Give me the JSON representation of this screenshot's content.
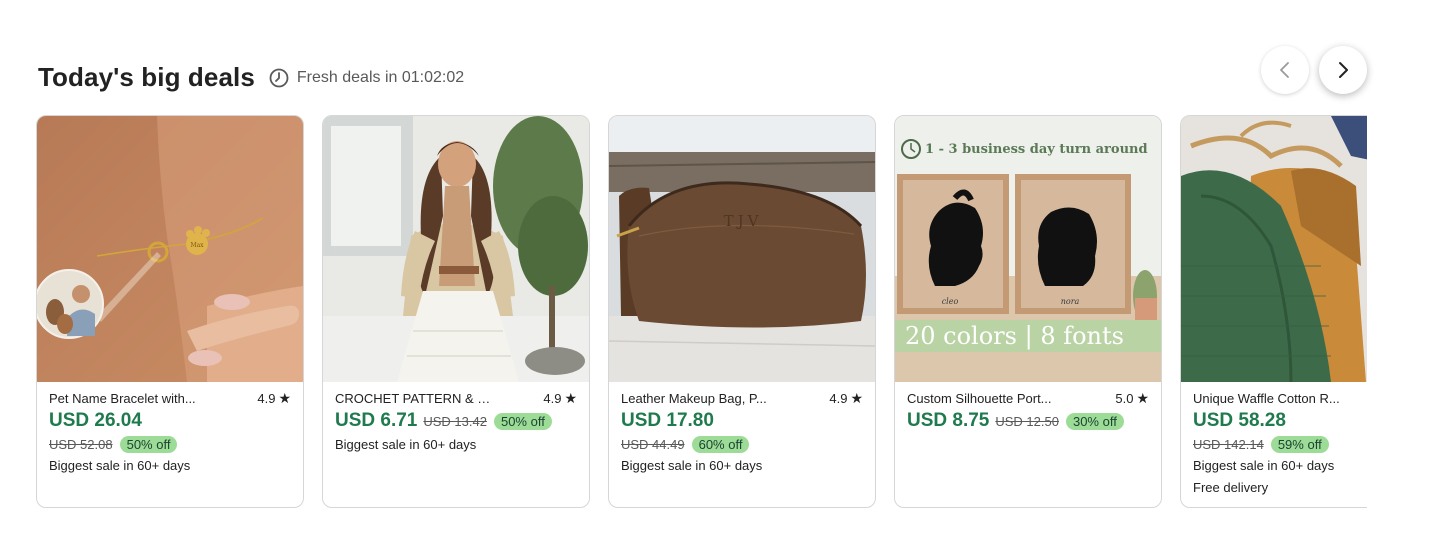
{
  "header": {
    "title": "Today's big deals",
    "timer_label": "Fresh deals in 01:02:02"
  },
  "nav": {
    "prev_icon": "chevron-left-icon",
    "next_icon": "chevron-right-icon"
  },
  "products": [
    {
      "title": "Pet Name Bracelet with...",
      "rating": "4.9",
      "price": "USD 26.04",
      "original_price": "USD 52.08",
      "discount": "50% off",
      "note": "Biggest sale in 60+ days",
      "delivery": ""
    },
    {
      "title": "CROCHET PATTERN & V...",
      "rating": "4.9",
      "price": "USD 6.71",
      "original_price": "USD 13.42",
      "discount": "50% off",
      "note": "Biggest sale in 60+ days",
      "delivery": ""
    },
    {
      "title": "Leather Makeup Bag, P...",
      "rating": "4.9",
      "price": "USD 17.80",
      "original_price": "USD 44.49",
      "discount": "60% off",
      "note": "Biggest sale in 60+ days",
      "delivery": ""
    },
    {
      "title": "Custom Silhouette Port...",
      "rating": "5.0",
      "price": "USD 8.75",
      "original_price": "USD 12.50",
      "discount": "30% off",
      "note": "",
      "delivery": ""
    },
    {
      "title": "Unique Waffle Cotton R...",
      "rating": "",
      "price": "USD 58.28",
      "original_price": "USD 142.14",
      "discount": "59% off",
      "note": "Biggest sale in 60+ days",
      "delivery": "Free delivery"
    }
  ],
  "image_text": {
    "bracelet_charm": "Max",
    "bag_monogram": "TJV",
    "silhouette_banner": "1 - 3 business day turn around",
    "silhouette_name_1": "cleo",
    "silhouette_name_2": "nora",
    "silhouette_promo": "20 colors | 8 fonts"
  },
  "colors": {
    "price_green": "#1f7a4d",
    "badge_green": "#9ddc97",
    "badge_text": "#1b4332"
  }
}
